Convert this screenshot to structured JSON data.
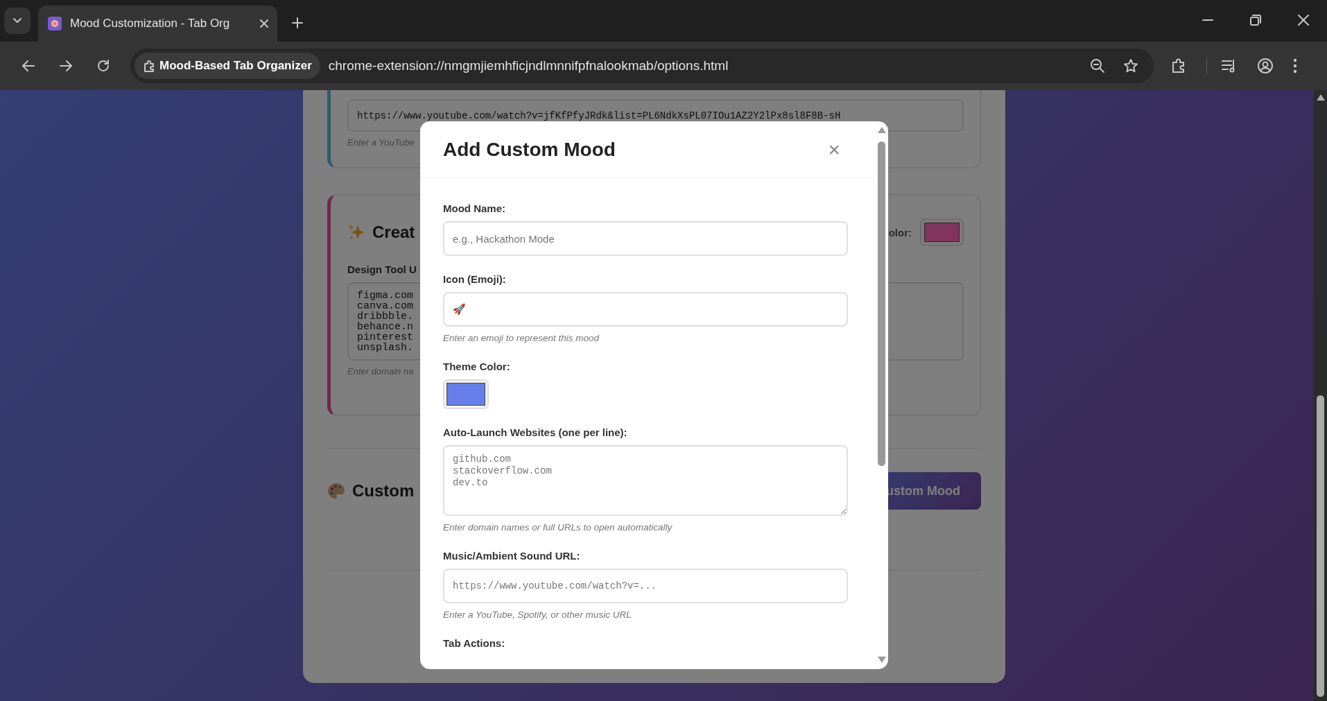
{
  "browser": {
    "tab_title": "Mood Customization - Tab Org",
    "site_chip": "Mood-Based Tab Organizer",
    "url": "chrome-extension://nmgmjiemhficjndlmnnifpfnalookmab/options.html"
  },
  "page": {
    "music_card": {
      "url_value": "https://www.youtube.com/watch?v=jfKfPfyJRdk&list=PL6NdkXsPL07IOu1AZ2Y2lPx8sl8F8B-sH",
      "hint": "Enter a YouTube"
    },
    "creative_card": {
      "title": "Creat",
      "color_label": "olor:",
      "color": "#82355c",
      "design_label": "Design Tool U",
      "design_lines": [
        "figma.com",
        "canva.com",
        "dribbble.",
        "behance.n",
        "pinterest",
        "unsplash."
      ],
      "hint": "Enter domain na"
    },
    "custom_section": {
      "title": "Custom",
      "button": "ustom Mood"
    }
  },
  "modal": {
    "title": "Add Custom Mood",
    "close": "×",
    "fields": [
      {
        "kind": "text",
        "label": "Mood Name:",
        "placeholder": "e.g., Hackathon Mode"
      },
      {
        "kind": "text",
        "label": "Icon (Emoji):",
        "value": "🚀",
        "hint": "Enter an emoji to represent this mood"
      },
      {
        "kind": "color",
        "label": "Theme Color:",
        "color": "#667eea"
      },
      {
        "kind": "textarea",
        "label": "Auto-Launch Websites (one per line):",
        "placeholder": "github.com\nstackoverflow.com\ndev.to",
        "hint": "Enter domain names or full URLs to open automatically"
      },
      {
        "kind": "url",
        "label": "Music/Ambient Sound URL:",
        "placeholder": "https://www.youtube.com/watch?v=...",
        "hint": "Enter a YouTube, Spotify, or other music URL"
      },
      {
        "kind": "section",
        "label": "Tab Actions:"
      }
    ]
  }
}
